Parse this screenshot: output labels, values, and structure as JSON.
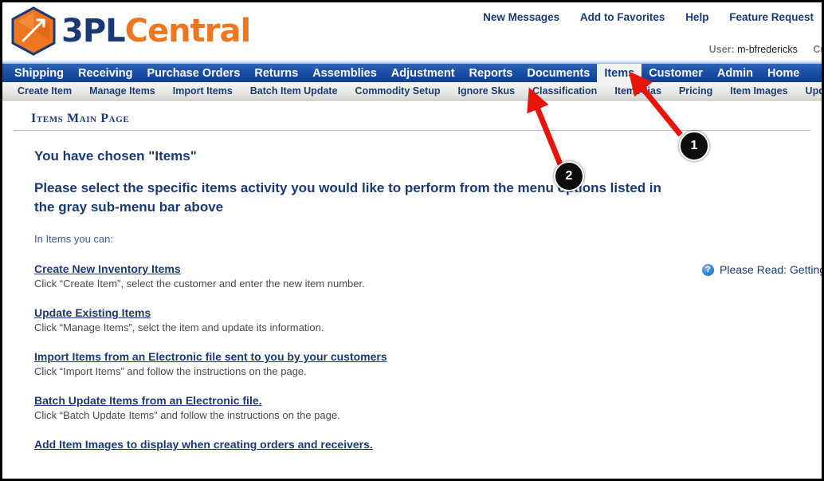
{
  "brand": {
    "logo_icon": "orange-cube-logo-icon",
    "name_part1": "3PL",
    "name_part2": "Central"
  },
  "header": {
    "links": [
      {
        "label": "New Messages",
        "name": "new-messages-link"
      },
      {
        "label": "Add to Favorites",
        "name": "add-to-favorites-link"
      },
      {
        "label": "Help",
        "name": "help-link"
      },
      {
        "label": "Feature Request",
        "name": "feature-request-link"
      }
    ],
    "user_label": "User:",
    "user_value": "m-bfredericks",
    "customer_label_truncated": "Cu"
  },
  "main_nav": {
    "active": "Items",
    "items": [
      {
        "label": "Shipping",
        "name": "nav-shipping"
      },
      {
        "label": "Receiving",
        "name": "nav-receiving"
      },
      {
        "label": "Purchase Orders",
        "name": "nav-purchase-orders"
      },
      {
        "label": "Returns",
        "name": "nav-returns"
      },
      {
        "label": "Assemblies",
        "name": "nav-assemblies"
      },
      {
        "label": "Adjustment",
        "name": "nav-adjustment"
      },
      {
        "label": "Reports",
        "name": "nav-reports"
      },
      {
        "label": "Documents",
        "name": "nav-documents"
      },
      {
        "label": "Items",
        "name": "nav-items"
      },
      {
        "label": "Customer",
        "name": "nav-customer"
      },
      {
        "label": "Admin",
        "name": "nav-admin"
      },
      {
        "label": "Home",
        "name": "nav-home"
      }
    ]
  },
  "sub_nav": {
    "items": [
      {
        "label": "Create Item",
        "name": "subnav-create-item"
      },
      {
        "label": "Manage Items",
        "name": "subnav-manage-items"
      },
      {
        "label": "Import Items",
        "name": "subnav-import-items"
      },
      {
        "label": "Batch Item Update",
        "name": "subnav-batch-item-update"
      },
      {
        "label": "Commodity Setup",
        "name": "subnav-commodity-setup"
      },
      {
        "label": "Ignore Skus",
        "name": "subnav-ignore-skus"
      },
      {
        "label": "Classification",
        "name": "subnav-classification"
      },
      {
        "label": "Item Alias",
        "name": "subnav-item-alias"
      },
      {
        "label": "Pricing",
        "name": "subnav-pricing"
      },
      {
        "label": "Item Images",
        "name": "subnav-item-images"
      },
      {
        "label": "Update Storag",
        "name": "subnav-update-storage"
      }
    ]
  },
  "page": {
    "title": "Items Main Page",
    "heading_chosen": "You have chosen \"Items\"",
    "heading_select": "Please select the specific items activity you would like to perform from the menu options listed in the gray sub-menu bar above",
    "intro": "In Items you can:",
    "please_read": {
      "icon": "question-mark-icon",
      "text": "Please Read: Getting"
    },
    "links": [
      {
        "title": "Create New Inventory Items",
        "desc": "Click “Create Item”, select the customer and enter the new item number.",
        "name": "link-create-new-inventory-items"
      },
      {
        "title": "Update Existing Items",
        "desc": "Click “Manage Items”, selct the item and update its information.",
        "name": "link-update-existing-items"
      },
      {
        "title": "Import Items from an Electronic file sent to you by your customers",
        "desc": "Click “Import Items” and follow the instructions on the page.",
        "name": "link-import-items"
      },
      {
        "title": "Batch Update Items from an Electronic file.",
        "desc": "Click “Batch Update Items” and follow the instructions on the page.",
        "name": "link-batch-update-items"
      },
      {
        "title": "Add Item Images to display when creating orders and receivers.",
        "desc": "",
        "name": "link-add-item-images"
      }
    ]
  },
  "annotations": {
    "color": "#e8140a",
    "callouts": [
      {
        "number": "1",
        "target": "Items",
        "name": "callout-badge-1"
      },
      {
        "number": "2",
        "target": "Classification",
        "name": "callout-badge-2"
      }
    ]
  },
  "colors": {
    "nav_blue": "#123f92",
    "brand_navy": "#1b3a75",
    "brand_orange": "#ef7621",
    "annotation_red": "#e8140a"
  }
}
